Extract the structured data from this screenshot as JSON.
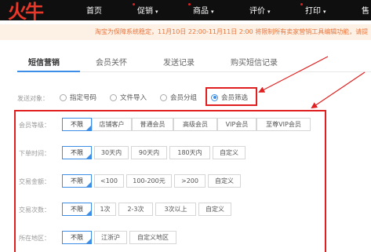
{
  "nav": {
    "logo_text": "火牛",
    "items": [
      {
        "label": "首页",
        "has_caret": false
      },
      {
        "label": "促销",
        "has_caret": true
      },
      {
        "label": "商品",
        "has_caret": true
      },
      {
        "label": "评价",
        "has_caret": true
      },
      {
        "label": "打印",
        "has_caret": true
      },
      {
        "label": "售",
        "has_caret": false
      }
    ],
    "caret": "▾"
  },
  "notice": {
    "text": "淘宝为保障系统稳定，11月10日 22:00-11月11日 2:00 将限制所有卖家营销工具编辑功能，请提"
  },
  "tabs": [
    {
      "label": "短信营销",
      "active": true
    },
    {
      "label": "会员关怀",
      "active": false
    },
    {
      "label": "发送记录",
      "active": false
    },
    {
      "label": "购买短信记录",
      "active": false
    }
  ],
  "send_target": {
    "label": "发送对象：",
    "options": [
      {
        "label": "指定号码",
        "checked": false
      },
      {
        "label": "文件导入",
        "checked": false
      },
      {
        "label": "会员分组",
        "checked": false
      },
      {
        "label": "会员筛选",
        "checked": true
      }
    ]
  },
  "filters": [
    {
      "label": "会员等级：",
      "options": [
        "不限",
        "店铺客户",
        "普通会员",
        "高级会员",
        "VIP会员",
        "至尊VIP会员"
      ],
      "selected": 0
    },
    {
      "label": "下单时间：",
      "options": [
        "不限",
        "30天内",
        "90天内",
        "180天内",
        "自定义"
      ],
      "selected": 0
    },
    {
      "label": "交易金额：",
      "options": [
        "不限",
        "<100",
        "100-200元",
        ">200",
        "自定义"
      ],
      "selected": 0
    },
    {
      "label": "交易次数：",
      "options": [
        "不限",
        "1次",
        "2-3次",
        "3次以上",
        "自定义"
      ],
      "selected": 0
    },
    {
      "label": "所在地区：",
      "options": [
        "不限",
        "江浙沪",
        "自定义地区"
      ],
      "selected": 0
    }
  ],
  "colors": {
    "accent": "#3d8ee6",
    "annotation_red": "#e02020",
    "notice_bg": "#fdf1e6",
    "notice_text": "#e8743a",
    "nav_bg": "#0f0f0f"
  }
}
